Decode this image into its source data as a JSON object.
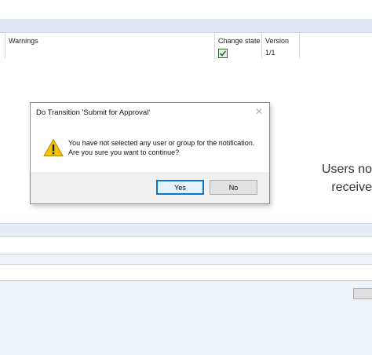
{
  "grid": {
    "columns": {
      "warnings": "Warnings",
      "change_state": "Change state",
      "version": "Version"
    },
    "row": {
      "change_state_checked": true,
      "version": "1/1"
    }
  },
  "background": {
    "line1": "Users no",
    "line2": "receive"
  },
  "dialog": {
    "title": "Do Transition 'Submit for Approval'",
    "close_glyph": "✕",
    "message_line1": "You have not selected any user or group for the notification.",
    "message_line2": "Are you sure you want to continue?",
    "icon": "warning-icon",
    "buttons": {
      "yes": "Yes",
      "no": "No"
    }
  },
  "colors": {
    "accent": "#0078d7",
    "warning": "#f6c300",
    "check": "#2a6b2a"
  }
}
